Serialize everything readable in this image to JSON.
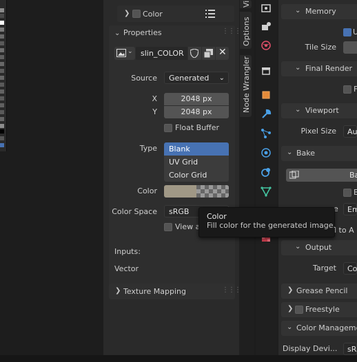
{
  "colors": {
    "accent": "#4772b3",
    "bg": "#1d1d1d",
    "panel": "#2a2a2a",
    "field": "#545454",
    "orange": "#e58c3a",
    "teal": "#44c4a0",
    "blue": "#4aa0e6",
    "swatch": "#a09886"
  },
  "npanel": {
    "color_section": {
      "label": "Color"
    },
    "properties": {
      "title": "Properties",
      "image_name": "slin_COLOR",
      "source_label": "Source",
      "source_value": "Generated",
      "x_label": "X",
      "x_value": "2048 px",
      "y_label": "Y",
      "y_value": "2048 px",
      "float_buffer": "Float Buffer",
      "type_label": "Type",
      "type_options": [
        "Blank",
        "UV Grid",
        "Color Grid"
      ],
      "type_selected": "Blank",
      "color_label": "Color",
      "colorspace_label": "Color Space",
      "colorspace_value": "sRGB",
      "view_as": "View a",
      "inputs": "Inputs:",
      "vector": "Vector"
    },
    "texture_mapping": {
      "title": "Texture Mapping"
    }
  },
  "tabs": {
    "top": "Vi",
    "options": "Options",
    "node_wrangler": "Node Wrangler"
  },
  "icons": [
    "render-icon",
    "output-icon",
    "view-layer-icon",
    "scene-icon",
    "world-icon",
    "collection-icon",
    "object-icon",
    "modifier-icon",
    "particles-icon",
    "physics-icon",
    "constraints-icon",
    "data-icon",
    "material-icon"
  ],
  "render_props": {
    "memory": "Memory",
    "use_label": "U",
    "tile_size": "Tile Size",
    "final_render": "Final Render",
    "final_chk_label": "F",
    "viewport": "Viewport",
    "pixel_size": "Pixel Size",
    "pixel_size_value": "Au",
    "bake": "Bake",
    "bake_button": "Ba",
    "bake_chk_label": "B",
    "em_label": "e",
    "em_value": "Em",
    "selected_to_active": "ted to A",
    "output": "Output",
    "target_label": "Target",
    "target_value": "Co",
    "grease_pencil": "Grease Pencil",
    "freestyle": "Freestyle",
    "color_management": "Color Manageme",
    "display_device_label": "Display Devi...",
    "display_device_value": "sRG"
  },
  "tooltip": {
    "title": "Color",
    "body": "Fill color for the generated image."
  }
}
